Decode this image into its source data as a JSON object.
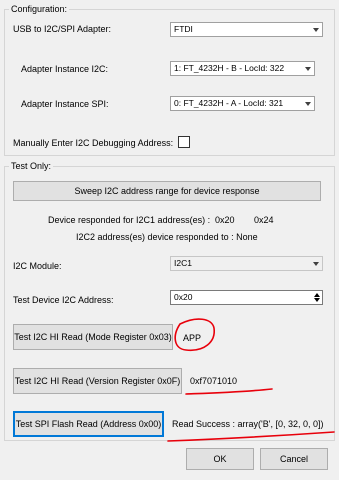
{
  "configuration": {
    "legend": "Configuration:",
    "adapter_label": "USB to I2C/SPI Adapter:",
    "adapter_value": "FTDI",
    "i2c_instance_label": "Adapter Instance I2C:",
    "i2c_instance_value": "1: FT_4232H - B - LocId: 322",
    "spi_instance_label": "Adapter Instance SPI:",
    "spi_instance_value": "0: FT_4232H - A - LocId: 321",
    "manual_address_label": "Manually Enter I2C Debugging Address:",
    "manual_address_checked": false
  },
  "test_only": {
    "legend": "Test Only:",
    "sweep_button": "Sweep I2C address range for device response",
    "i2c1_response_label": "Device responded for I2C1 address(es) :",
    "i2c1_addresses": [
      "0x20",
      "0x24"
    ],
    "i2c2_response_text": "I2C2 address(es) device responded to : None",
    "module_label": "I2C Module:",
    "module_value": "I2C1",
    "device_address_label": "Test Device I2C Address:",
    "device_address_value": "0x20",
    "mode_read_button": "Test I2C HI Read (Mode Register 0x03)",
    "mode_read_result": "APP",
    "version_read_button": "Test I2C HI Read (Version Register 0x0F)",
    "version_read_result": "0xf7071010",
    "spi_read_button": "Test SPI Flash Read (Address 0x00)",
    "spi_read_result": "Read Success : array('B', [0, 32, 0, 0])"
  },
  "footer": {
    "ok_label": "OK",
    "cancel_label": "Cancel"
  },
  "annotation_color": "#e8000b"
}
